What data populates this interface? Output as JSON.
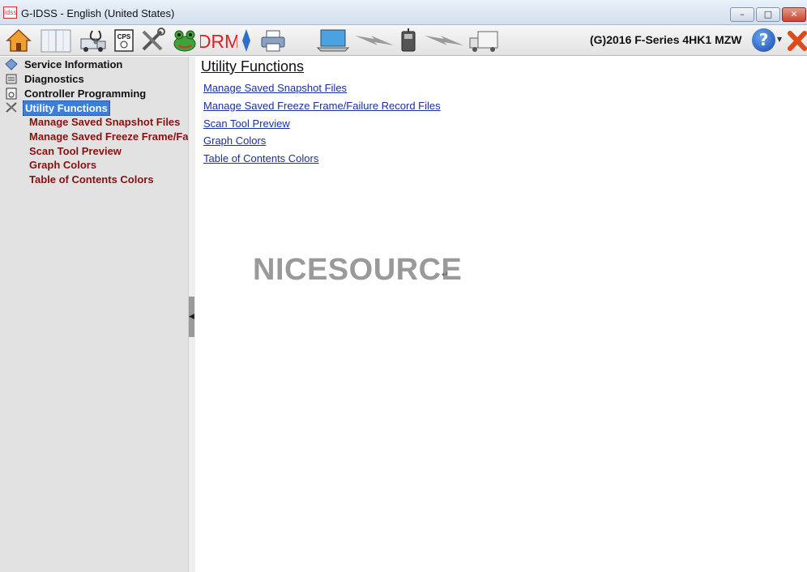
{
  "window": {
    "app_icon_text": "idss",
    "title": "G-IDSS - English (United States)",
    "min_glyph": "–",
    "max_glyph": "□",
    "close_glyph": "✕"
  },
  "toolbar": {
    "buttons": [
      {
        "name": "home-icon"
      },
      {
        "name": "book-icon"
      },
      {
        "name": "diagnostics-truck-icon"
      },
      {
        "name": "cps-icon",
        "label": "CPS"
      },
      {
        "name": "tools-icon"
      },
      {
        "name": "frog-icon"
      },
      {
        "name": "drm-icon",
        "label": "DRM"
      },
      {
        "name": "pointer-icon"
      },
      {
        "name": "printer-icon"
      },
      {
        "name": "laptop-icon"
      },
      {
        "name": "lightning-icon"
      },
      {
        "name": "interface-device-icon"
      },
      {
        "name": "lightning-icon-2"
      },
      {
        "name": "vehicle-icon"
      }
    ],
    "vehicle_label": "(G)2016 F-Series 4HK1 MZW",
    "help_glyph": "?",
    "help_arrow": "▼",
    "accent_color": "#1548a8",
    "exit_color": "#e04a1a"
  },
  "sidebar": {
    "items": [
      {
        "label": "Service Information",
        "icon": "service-info-icon"
      },
      {
        "label": "Diagnostics",
        "icon": "diagnostics-icon"
      },
      {
        "label": "Controller Programming",
        "icon": "controller-programming-icon"
      },
      {
        "label": "Utility Functions",
        "icon": "utility-tools-icon",
        "selected": true
      }
    ],
    "sub_items": [
      {
        "label": "Manage Saved Snapshot Files"
      },
      {
        "label": "Manage Saved Freeze Frame/Failure Record Files"
      },
      {
        "label": "Scan Tool Preview"
      },
      {
        "label": "Graph Colors"
      },
      {
        "label": "Table of Contents Colors"
      }
    ],
    "splitter_glyph": "◀",
    "selected_color": "#3b7fd9",
    "sub_item_color": "#8a1010"
  },
  "main": {
    "title": "Utility Functions",
    "links": [
      {
        "label": "Manage Saved Snapshot Files"
      },
      {
        "label": "Manage Saved Freeze Frame/Failure Record Files"
      },
      {
        "label": "Scan Tool Preview"
      },
      {
        "label": "Graph Colors"
      },
      {
        "label": "Table of Contents Colors"
      }
    ],
    "link_color": "#1a2fa0"
  },
  "watermark": {
    "text": "NICESOURCE",
    "mark": "↵"
  }
}
